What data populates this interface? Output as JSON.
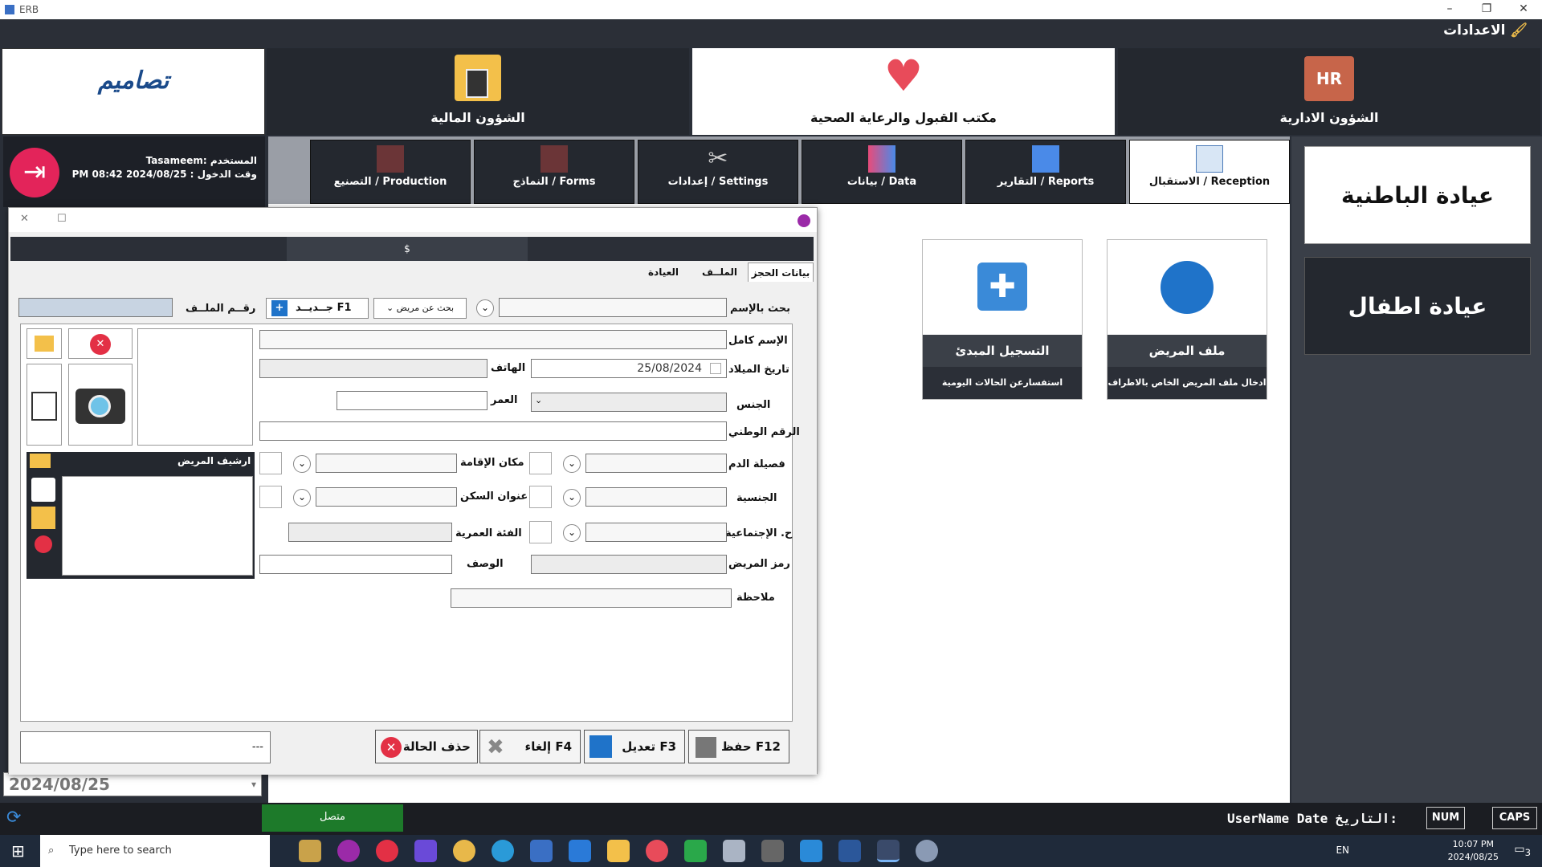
{
  "window": {
    "title": "ERB"
  },
  "menu": {
    "settings": "الاعدادات"
  },
  "modules": {
    "hr": "الشؤون الادارية",
    "admission": "مكتب القبول والرعاية الصحية",
    "finance": "الشؤون المالية",
    "hr_icon_text": "HR",
    "logo": "تصاميم"
  },
  "user": {
    "user_line": "المستخدم :Tasameem",
    "login_line": "وقت الدخول : 2024/08/25 PM 08:42"
  },
  "tabs": [
    "الاستقبال / Reception",
    "التقارير / Reports",
    "بيانات / Data",
    "إعدادات / Settings",
    "النماذج / Forms",
    "التصنيع / Production"
  ],
  "cards": [
    {
      "title": "ملف المريض",
      "desc": "ادخال ملف المريض الخاص بالاطراف"
    },
    {
      "title": "التسجيل المبدئ",
      "desc": "استفسارعن الحالات اليومية"
    }
  ],
  "clinics": [
    "عيادة الباطنية",
    "عيادة اطفال"
  ],
  "dialog": {
    "band_text": "$",
    "tabs": [
      "بيانات الحجز",
      "الملــف",
      "العيادة"
    ],
    "labels": {
      "search_name": "بحث بالإسم",
      "search_patient": "بحث عن مريض",
      "new": "جــديــد F1",
      "file_no": "رقــم الملــف",
      "full_name": "الإسم كامل",
      "dob": "تاريخ الميلاد",
      "phone": "الهاتف",
      "gender": "الجنس",
      "age": "العمر",
      "national_id": "الرقم الوطني",
      "blood": "فصيلة الدم",
      "residence": "مكان الإقامة",
      "nationality": "الجنسية",
      "address": "عنوان السكن",
      "social": "ح. الإجتماعية",
      "age_group": "الفئة العمرية",
      "patient_code": "رمز المريض",
      "description": "الوصف",
      "note": "ملاحظة",
      "archive": "ارشيف المريض"
    },
    "dob_value": "25/08/2024",
    "bottom_left": "---",
    "buttons": {
      "save": "حفظ F12",
      "edit": "تعديل F3",
      "cancel": "إلغاء F4",
      "delete": "حذف الحالة"
    }
  },
  "date_box": "2024/08/25",
  "status": {
    "connected": "متصل",
    "user": "UserName",
    "date": "Date",
    "date_lbl": "التاريخ:",
    "num": "NUM",
    "caps": "CAPS"
  },
  "taskbar": {
    "search": "Type here to search",
    "lang": "EN",
    "time": "10:07 PM",
    "date": "2024/08/25",
    "notif": "3"
  }
}
